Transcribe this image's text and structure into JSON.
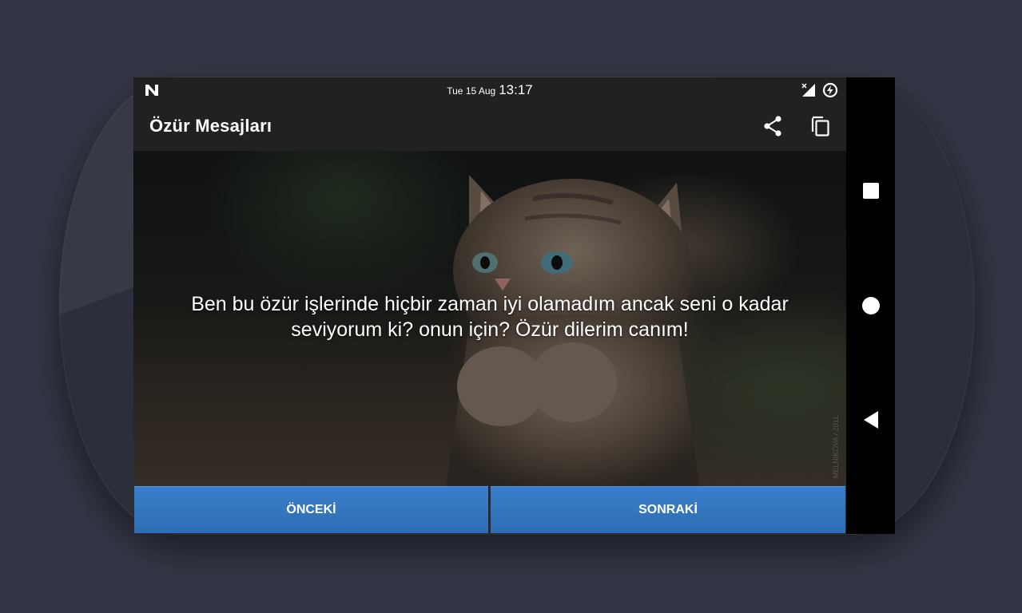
{
  "status_bar": {
    "date": "Tue 15 Aug",
    "time": "13:17",
    "left_icon": "n-notification-icon",
    "right_icons": [
      "no-signal-icon",
      "battery-charging-icon"
    ]
  },
  "toolbar": {
    "title": "Özür Mesajları",
    "share_icon": "share-icon",
    "copy_icon": "copy-icon"
  },
  "content": {
    "message": "Ben bu özür işlerinde hiçbir zaman iyi olamadım ancak seni o kadar seviyorum ki? onun için? Özür dilerim canım!",
    "background_image": "praying-kitten-photo",
    "watermark": "MELNIKOVA / 2011"
  },
  "buttons": {
    "prev_label": "ÖNCEKİ",
    "next_label": "SONRAKİ"
  },
  "nav_bar": {
    "icons": [
      "recents-square-icon",
      "home-circle-icon",
      "back-triangle-icon"
    ]
  },
  "colors": {
    "toolbar_bg": "#212121",
    "button_blue": "#3277c2",
    "device_background": "#323644"
  }
}
